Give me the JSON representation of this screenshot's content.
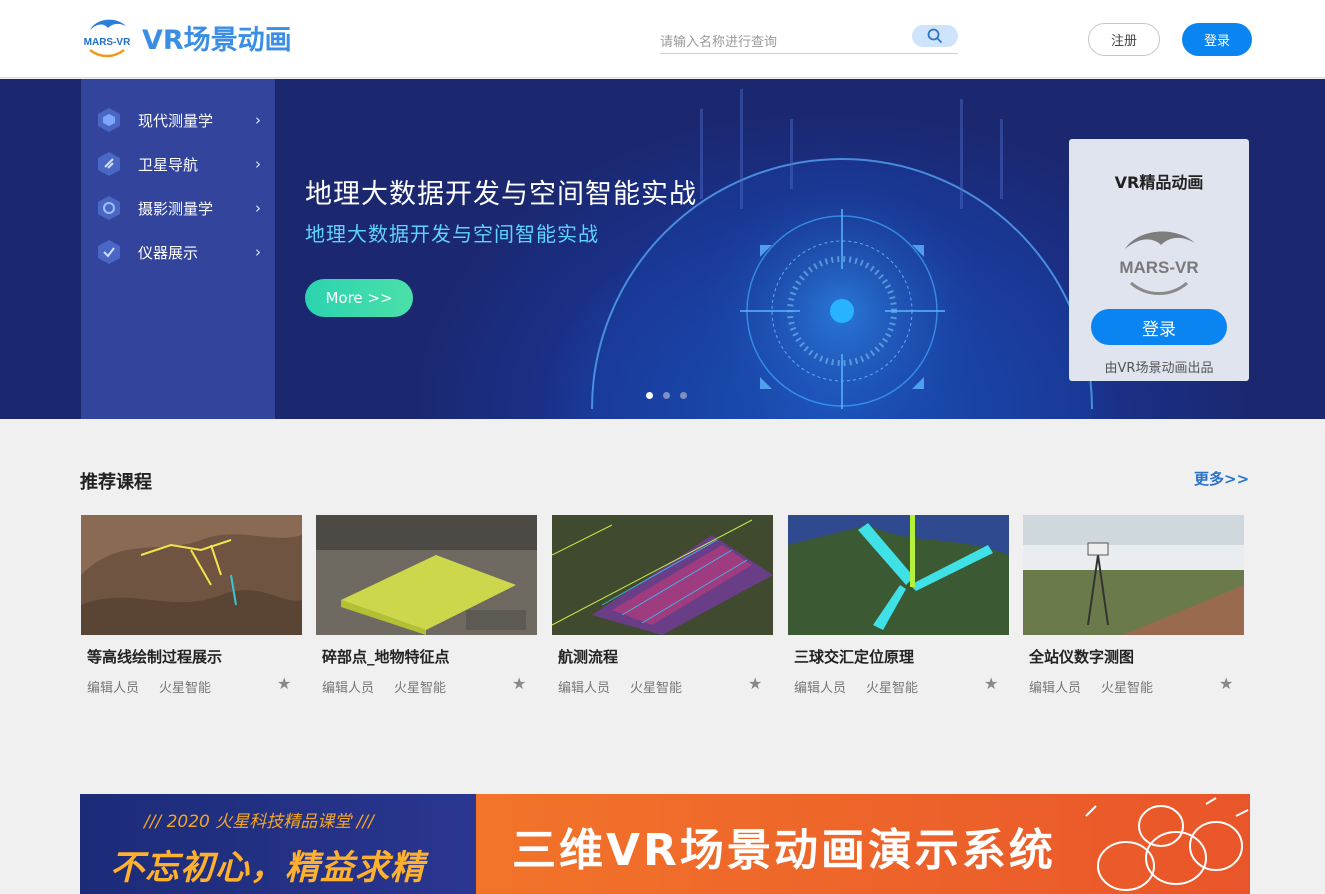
{
  "header": {
    "logo_text": "MARS-VR",
    "brand": "VR场景动画",
    "search_placeholder": "请输入名称进行查询",
    "register_label": "注册",
    "login_label": "登录"
  },
  "banner": {
    "menu": [
      {
        "label": "现代测量学",
        "icon": "cube-icon"
      },
      {
        "label": "卫星导航",
        "icon": "satellite-icon"
      },
      {
        "label": "摄影测量学",
        "icon": "camera-icon"
      },
      {
        "label": "仪器展示",
        "icon": "instrument-icon"
      }
    ],
    "title": "地理大数据开发与空间智能实战",
    "subtitle": "地理大数据开发与空间智能实战",
    "more_label": "More >>",
    "slide_count": 3,
    "active_slide": 0
  },
  "vr_card": {
    "title": "VR精品动画",
    "logo_text": "MARS-VR",
    "login_label": "登录",
    "note": "由VR场景动画出品"
  },
  "recommend": {
    "title": "推荐课程",
    "more_label": "更多>>",
    "courses": [
      {
        "name": "等高线绘制过程展示",
        "editor_label": "编辑人员",
        "editor": "火星智能"
      },
      {
        "name": "碎部点_地物特征点",
        "editor_label": "编辑人员",
        "editor": "火星智能"
      },
      {
        "name": "航测流程",
        "editor_label": "编辑人员",
        "editor": "火星智能"
      },
      {
        "name": "三球交汇定位原理",
        "editor_label": "编辑人员",
        "editor": "火星智能"
      },
      {
        "name": "全站仪数字测图",
        "editor_label": "编辑人员",
        "editor": "火星智能"
      }
    ]
  },
  "ad": {
    "small_text": "/// 2020 火星科技精品课堂 ///",
    "big_text": "不忘初心，精益求精",
    "main_text": "三维VR场景动画演示系统"
  },
  "colors": {
    "accent": "#0a84f0",
    "brand": "#3a8ee6",
    "banner_bg": "#1b2870",
    "more_button": "#2bd3b0",
    "ad_orange": "#e9552a"
  }
}
